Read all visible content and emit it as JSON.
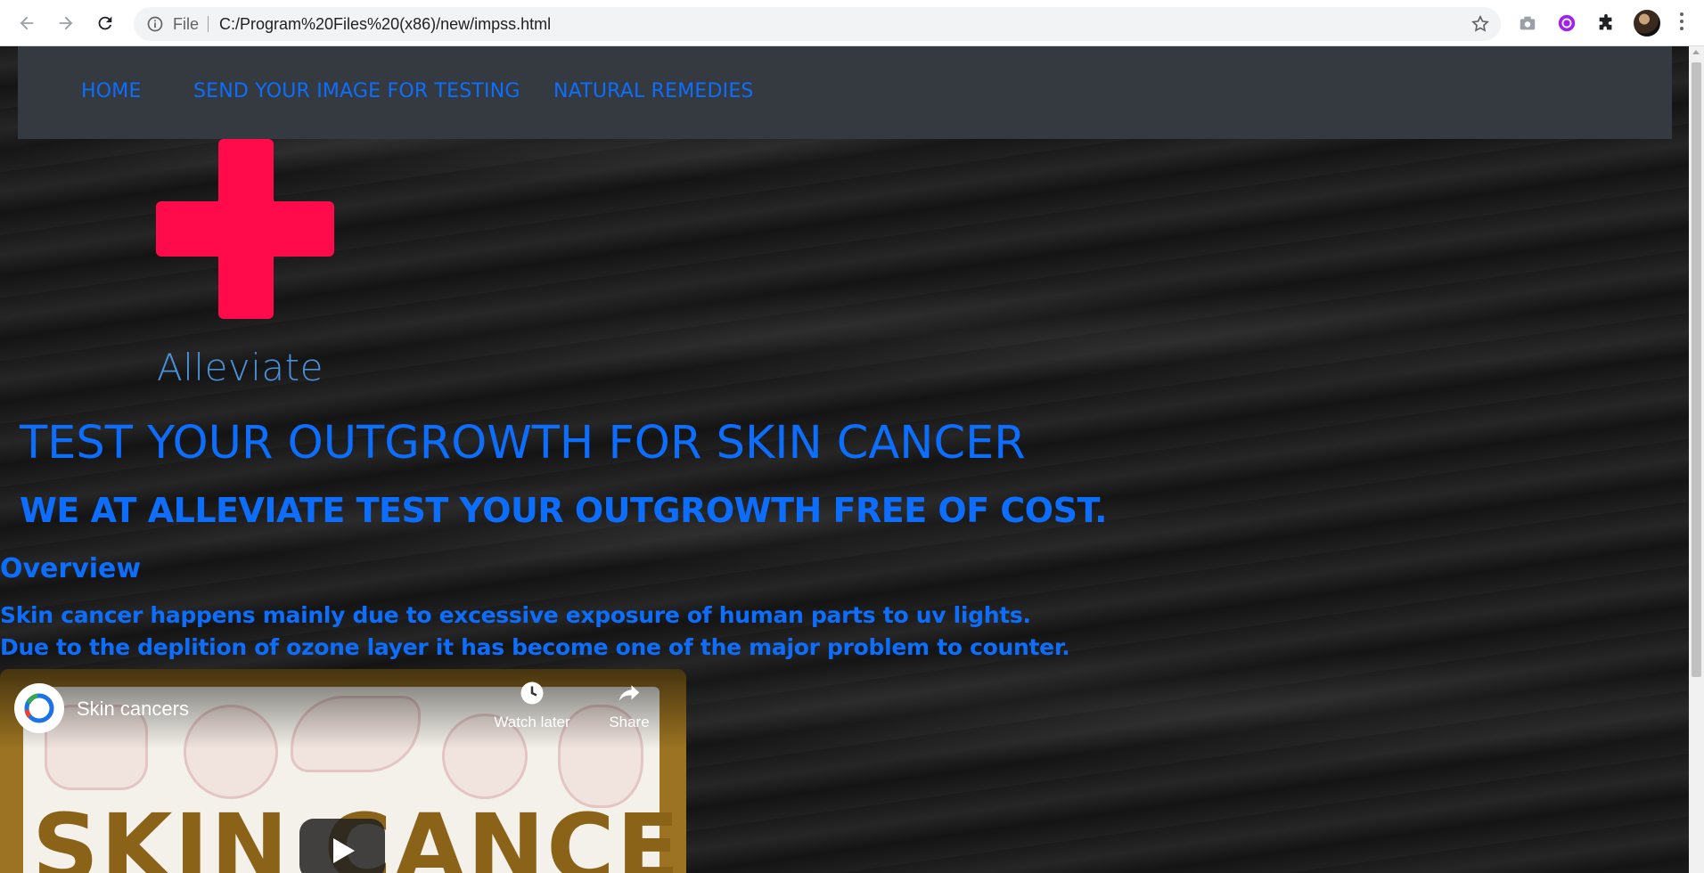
{
  "browser": {
    "file_label": "File",
    "url": "C:/Program%20Files%20(x86)/new/impss.html"
  },
  "nav": {
    "items": [
      "HOME",
      "SEND YOUR IMAGE FOR TESTING",
      "NATURAL REMEDIES"
    ]
  },
  "logo": {
    "text": "Alleviate"
  },
  "hero": {
    "title": "TEST YOUR OUTGROWTH FOR SKIN CANCER",
    "subtitle": "WE AT ALLEVIATE TEST YOUR OUTGROWTH FREE OF COST."
  },
  "overview": {
    "heading": "Overview",
    "lines": [
      "Skin cancer happens mainly due to excessive exposure of human parts to uv lights.",
      "Due to the deplition of ozone layer it has become one of the major problem to counter."
    ]
  },
  "video": {
    "title": "Skin cancers",
    "watch_later": "Watch later",
    "share": "Share",
    "thumbnail_text": "SKIN CANCERS"
  },
  "colors": {
    "link_blue": "#0d6efd",
    "nav_bg": "#343a40",
    "cross_red": "#ff0a4a"
  }
}
